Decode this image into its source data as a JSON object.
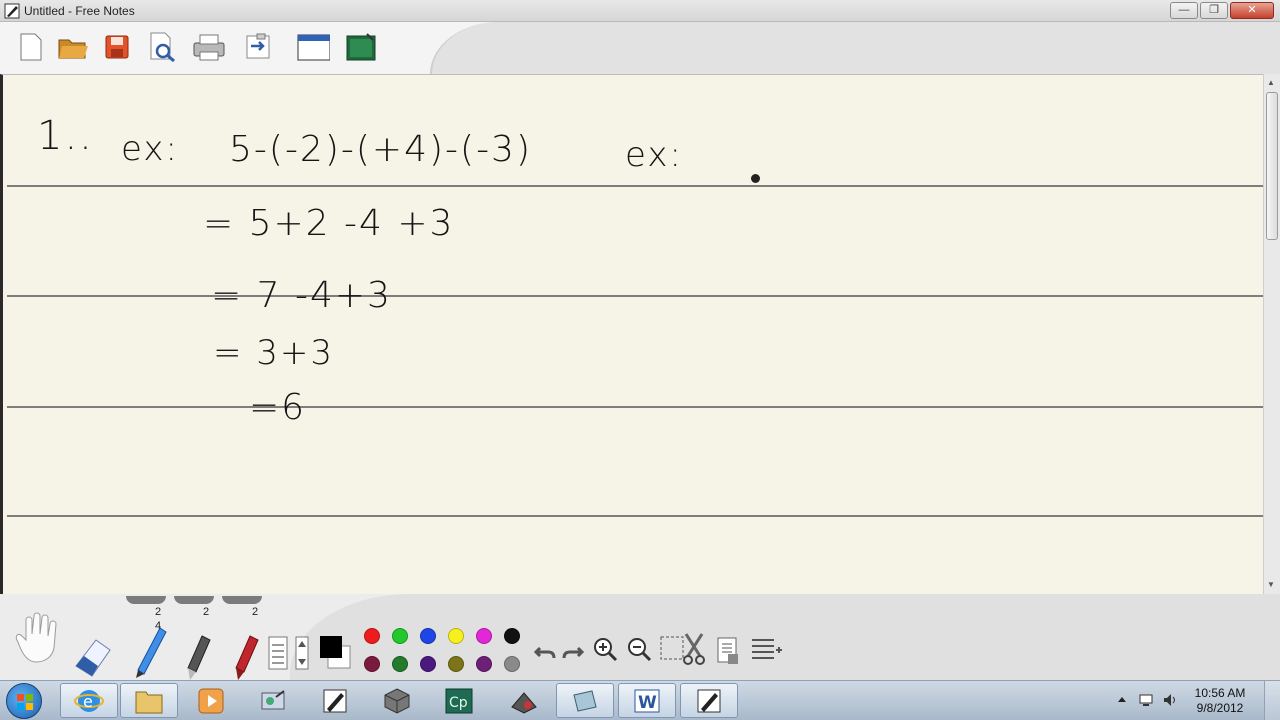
{
  "window": {
    "title": "Untitled - Free Notes",
    "minimize_label": "—",
    "restore_label": "❐",
    "close_label": "✕"
  },
  "toolbar": {
    "items": [
      "new-page",
      "open-folder",
      "save",
      "print-preview",
      "print",
      "export",
      "window",
      "green-board"
    ]
  },
  "notes": {
    "line1_num": "1..",
    "line1_ex": "ex:",
    "line1_expr": "5-(-2)-(+4)-(-3)",
    "line1_ex2": "ex:",
    "line2": "= 5+2 -4 +3",
    "line3": "= 7 -4+3",
    "line4": "= 3+3",
    "line5": "=6"
  },
  "tools": {
    "tab_counts": [
      "2",
      "2",
      "2"
    ],
    "sub_count": "4",
    "colors_top": [
      "#ee1c1c",
      "#21c92a",
      "#1e45e6",
      "#f6f11e",
      "#e326d6",
      "#111111"
    ],
    "colors_bottom": [
      "#7a1a3e",
      "#237a2b",
      "#4a1a7e",
      "#7b7518",
      "#6e1f77",
      "#8a8a8a"
    ]
  },
  "taskbar": {
    "time": "10:56 AM",
    "date": "9/8/2012",
    "apps": [
      "internet-explorer",
      "file-explorer",
      "media-player",
      "paint-tool",
      "free-notes",
      "3d-app",
      "captivate",
      "media-app",
      "notes-app",
      "word",
      "free-notes-active"
    ]
  }
}
